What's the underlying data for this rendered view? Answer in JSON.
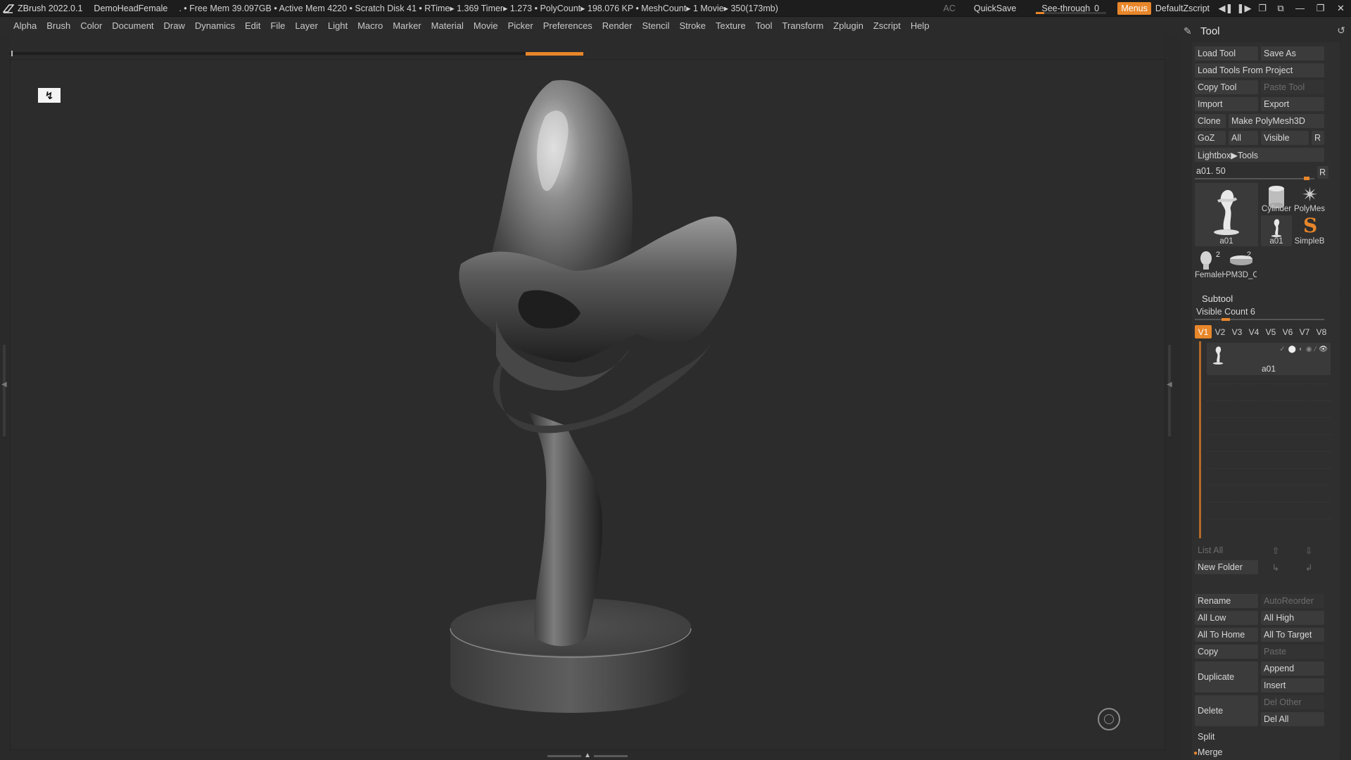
{
  "titlebar": {
    "app": "ZBrush 2022.0.1",
    "project": "DemoHeadFemale",
    "stats": ". • Free Mem 39.097GB • Active Mem 4220 • Scratch Disk 41 •  RTime▸ 1.369 Timer▸ 1.273 • PolyCount▸ 198.076 KP  • MeshCount▸ 1  Movie▸ 350(173mb)",
    "ac": "AC",
    "quicksave": "QuickSave",
    "seethrough_label": "See-through",
    "seethrough_value": "0",
    "seethrough_fraction": 0.12,
    "menus": "Menus",
    "script": "DefaultZscript"
  },
  "menubar": [
    "Alpha",
    "Brush",
    "Color",
    "Document",
    "Draw",
    "Dynamics",
    "Edit",
    "File",
    "Layer",
    "Light",
    "Macro",
    "Marker",
    "Material",
    "Movie",
    "Picker",
    "Preferences",
    "Render",
    "Stencil",
    "Stroke",
    "Texture",
    "Tool",
    "Transform",
    "Zplugin",
    "Zscript",
    "Help"
  ],
  "panel": {
    "title": "Tool",
    "buttons": {
      "load_tool": "Load Tool",
      "save_as": "Save As",
      "load_from_project": "Load Tools From Project",
      "copy_tool": "Copy Tool",
      "paste_tool": "Paste Tool",
      "import": "Import",
      "export": "Export",
      "clone": "Clone",
      "make_polymesh": "Make PolyMesh3D",
      "goz": "GoZ",
      "all": "All",
      "visible": "Visible",
      "r": "R",
      "lightbox": "Lightbox▶Tools"
    },
    "slider_label": "a01. 50",
    "slider_fraction": 0.96,
    "thumbs": {
      "main": "a01",
      "cylinder": "Cylinder",
      "polymesh": "PolyMes",
      "a01_small": "a01",
      "simpleb": "SimpleB",
      "female": "FemaleH",
      "female_count": "2",
      "pm3d": "PM3D_C",
      "pm3d_count": "2"
    },
    "subtool": {
      "header": "Subtool",
      "visible_count": "Visible Count 6",
      "tabs": [
        "V1",
        "V2",
        "V3",
        "V4",
        "V5",
        "V6",
        "V7",
        "V8"
      ],
      "item_name": "a01",
      "list_all": "List All",
      "new_folder": "New Folder",
      "rename": "Rename",
      "autoreorder": "AutoReorder",
      "all_low": "All Low",
      "all_high": "All High",
      "all_to_home": "All To Home",
      "all_to_target": "All To Target",
      "copy": "Copy",
      "paste": "Paste",
      "duplicate": "Duplicate",
      "append": "Append",
      "insert": "Insert",
      "delete": "Delete",
      "del_other": "Del Other",
      "del_all": "Del All",
      "split": "Split",
      "merge": "Merge"
    }
  },
  "colors": {
    "accent": "#e8862a",
    "background": "#2a2a2a",
    "viewport": "#2c2c2c"
  }
}
